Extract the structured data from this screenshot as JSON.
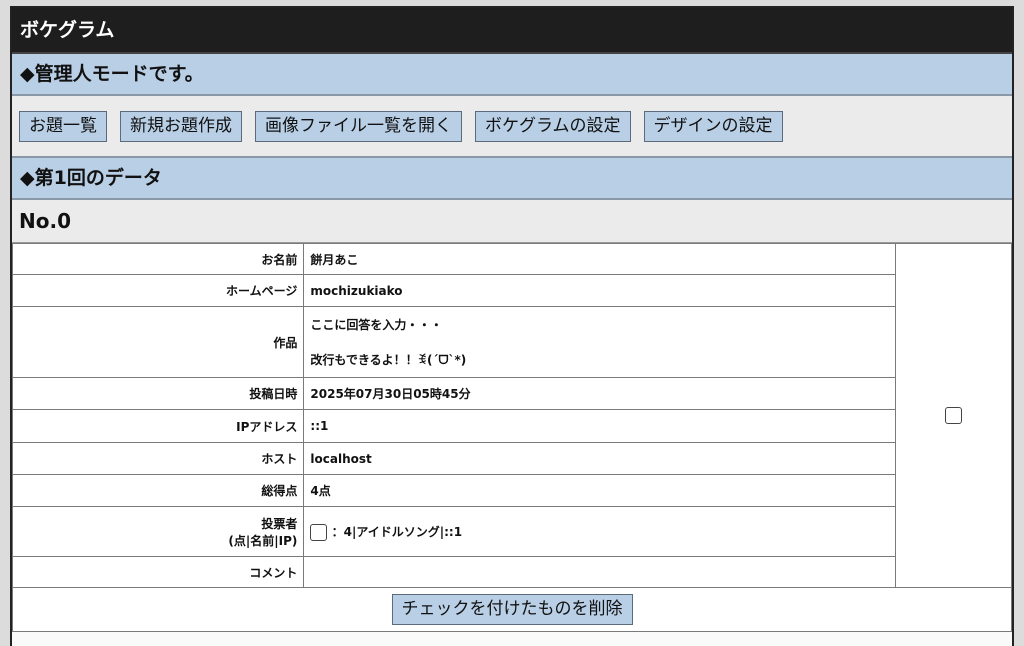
{
  "app": {
    "title": "ボケグラム"
  },
  "admin_notice": "◆管理人モードです。",
  "toolbar": {
    "buttons": [
      "お題一覧",
      "新規お題作成",
      "画像ファイル一覧を開く",
      "ボケグラムの設定",
      "デザインの設定"
    ]
  },
  "round_header": "◆第1回のデータ",
  "entry": {
    "number": "No.0",
    "rows": {
      "name": {
        "label": "お名前",
        "value": "餅月あこ"
      },
      "homepage": {
        "label": "ホームページ",
        "value": "mochizukiako"
      },
      "work": {
        "label": "作品",
        "line1": "ここに回答を入力・・・",
        "line2": "改行もできるよ！！ꉂ(ˊᗜˋ*)"
      },
      "posted": {
        "label": "投稿日時",
        "value": "2025年07月30日05時45分"
      },
      "ip": {
        "label": "IPアドレス",
        "value": "::1"
      },
      "host": {
        "label": "ホスト",
        "value": "localhost"
      },
      "score": {
        "label": "総得点",
        "value": "4点"
      },
      "voters": {
        "label1": "投票者",
        "label2": "(点|名前|IP)",
        "value": "：4|アイドルソング|::1"
      },
      "comment": {
        "label": "コメント",
        "value": ""
      }
    }
  },
  "delete_button": "チェックを付けたものを削除"
}
